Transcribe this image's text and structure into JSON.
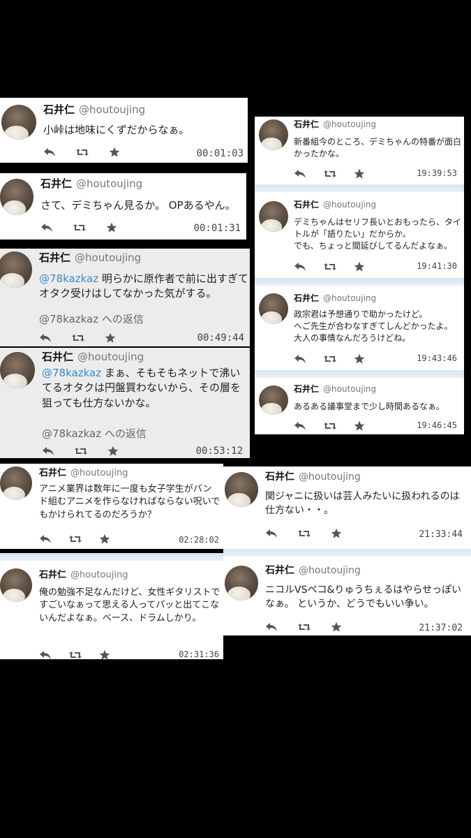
{
  "author": {
    "name": "石井仁",
    "handle": "@houtoujing"
  },
  "reply_prefix_tail": " への返信",
  "tweets": [
    {
      "text": "小峠は地味にくずだからなぁ。",
      "time": "00:01:03"
    },
    {
      "text": "さて、デミちゃん見るか。 OPあるやん。",
      "time": "00:01:31"
    },
    {
      "mention": "@78kazkaz",
      "text": " 明らかに原作者で前に出すぎてオタク受けはしてなかった気がする。",
      "reply_to": "@78kazkaz への返信",
      "time": "00:49:44"
    },
    {
      "mention": "@78kazkaz",
      "text": " まぁ、そもそもネットで沸いてるオタクは円盤買わないから、その層を狙っても仕方ないかな。",
      "reply_to": "@78kazkaz への返信",
      "time": "00:53:12"
    },
    {
      "text": "アニメ業界は数年に一度も女子学生がバンド組むアニメを作らなければならない呪いでもかけられてるのだろうか？",
      "time": "02:28:02"
    },
    {
      "text": "俺の勉強不足なんだけど、女性ギタリストですごいなぁって思える人ってパッと出てこないんだよなぁ。ベース、ドラムしかり。",
      "time": "02:31:36"
    },
    {
      "text": "新番組今のところ、デミちゃんの特番が面白かったかな。",
      "time": "19:39:53"
    },
    {
      "text": "デミちゃんはセリフ長いとおもったら、タイトルが「語りたい」だからか。\nでも、ちょっと間延びしてるんだよなぁ。",
      "time": "19:41:30"
    },
    {
      "text": "政宗君は予想通りで助かったけど。\nへご先生が合わなすぎてしんどかったよ。\n大人の事情なんだろうけどね。",
      "time": "19:43:46"
    },
    {
      "text": "あるある議事堂まで少し時間あるなぁ。",
      "time": "19:46:45"
    },
    {
      "text": "関ジャニに扱いは芸人みたいに扱われるのは仕方ない・・。",
      "time": "21:33:44"
    },
    {
      "text": "ニコルVSペコ&りゅうちぇるはやらせっぽいなぁ。 というか、どうでもいい争い。",
      "time": "21:37:02"
    }
  ],
  "colors": {
    "background": "#000000",
    "card": "#ffffff",
    "card_gray": "#ececec",
    "mention": "#3b88c3"
  },
  "icons": [
    "reply-icon",
    "retweet-icon",
    "star-icon"
  ]
}
